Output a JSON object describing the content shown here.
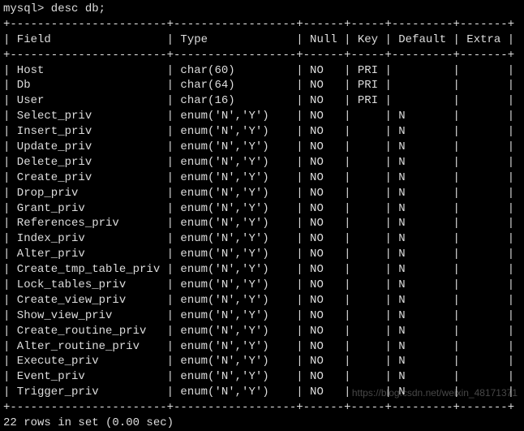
{
  "prompt": "mysql> desc db;",
  "border": "+-----------------------+------------------+------+-----+---------+-------+",
  "headers": {
    "field": "Field",
    "type": "Type",
    "null": "Null",
    "key": "Key",
    "default": "Default",
    "extra": "Extra"
  },
  "rows": [
    {
      "field": "Host",
      "type": "char(60)",
      "null": "NO",
      "key": "PRI",
      "default": "",
      "extra": ""
    },
    {
      "field": "Db",
      "type": "char(64)",
      "null": "NO",
      "key": "PRI",
      "default": "",
      "extra": ""
    },
    {
      "field": "User",
      "type": "char(16)",
      "null": "NO",
      "key": "PRI",
      "default": "",
      "extra": ""
    },
    {
      "field": "Select_priv",
      "type": "enum('N','Y')",
      "null": "NO",
      "key": "",
      "default": "N",
      "extra": ""
    },
    {
      "field": "Insert_priv",
      "type": "enum('N','Y')",
      "null": "NO",
      "key": "",
      "default": "N",
      "extra": ""
    },
    {
      "field": "Update_priv",
      "type": "enum('N','Y')",
      "null": "NO",
      "key": "",
      "default": "N",
      "extra": ""
    },
    {
      "field": "Delete_priv",
      "type": "enum('N','Y')",
      "null": "NO",
      "key": "",
      "default": "N",
      "extra": ""
    },
    {
      "field": "Create_priv",
      "type": "enum('N','Y')",
      "null": "NO",
      "key": "",
      "default": "N",
      "extra": ""
    },
    {
      "field": "Drop_priv",
      "type": "enum('N','Y')",
      "null": "NO",
      "key": "",
      "default": "N",
      "extra": ""
    },
    {
      "field": "Grant_priv",
      "type": "enum('N','Y')",
      "null": "NO",
      "key": "",
      "default": "N",
      "extra": ""
    },
    {
      "field": "References_priv",
      "type": "enum('N','Y')",
      "null": "NO",
      "key": "",
      "default": "N",
      "extra": ""
    },
    {
      "field": "Index_priv",
      "type": "enum('N','Y')",
      "null": "NO",
      "key": "",
      "default": "N",
      "extra": ""
    },
    {
      "field": "Alter_priv",
      "type": "enum('N','Y')",
      "null": "NO",
      "key": "",
      "default": "N",
      "extra": ""
    },
    {
      "field": "Create_tmp_table_priv",
      "type": "enum('N','Y')",
      "null": "NO",
      "key": "",
      "default": "N",
      "extra": ""
    },
    {
      "field": "Lock_tables_priv",
      "type": "enum('N','Y')",
      "null": "NO",
      "key": "",
      "default": "N",
      "extra": ""
    },
    {
      "field": "Create_view_priv",
      "type": "enum('N','Y')",
      "null": "NO",
      "key": "",
      "default": "N",
      "extra": ""
    },
    {
      "field": "Show_view_priv",
      "type": "enum('N','Y')",
      "null": "NO",
      "key": "",
      "default": "N",
      "extra": ""
    },
    {
      "field": "Create_routine_priv",
      "type": "enum('N','Y')",
      "null": "NO",
      "key": "",
      "default": "N",
      "extra": ""
    },
    {
      "field": "Alter_routine_priv",
      "type": "enum('N','Y')",
      "null": "NO",
      "key": "",
      "default": "N",
      "extra": ""
    },
    {
      "field": "Execute_priv",
      "type": "enum('N','Y')",
      "null": "NO",
      "key": "",
      "default": "N",
      "extra": ""
    },
    {
      "field": "Event_priv",
      "type": "enum('N','Y')",
      "null": "NO",
      "key": "",
      "default": "N",
      "extra": ""
    },
    {
      "field": "Trigger_priv",
      "type": "enum('N','Y')",
      "null": "NO",
      "key": "",
      "default": "N",
      "extra": ""
    }
  ],
  "summary": "22 rows in set (0.00 sec)",
  "watermark": "https://blog.csdn.net/weixin_48171371",
  "col_widths": {
    "field": 23,
    "type": 18,
    "null": 6,
    "key": 5,
    "default": 9,
    "extra": 7
  }
}
